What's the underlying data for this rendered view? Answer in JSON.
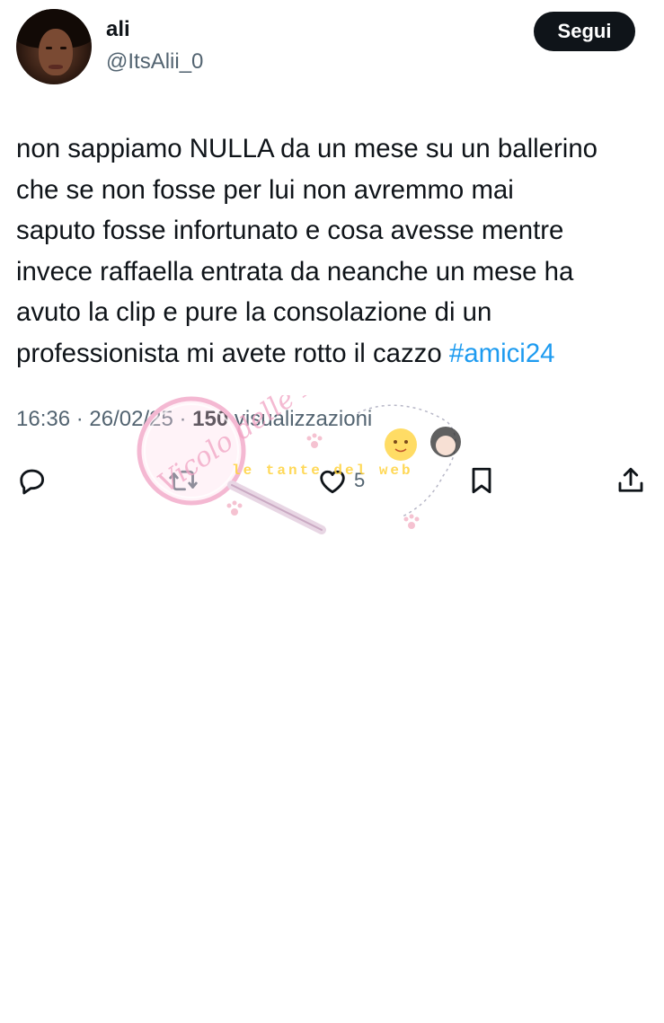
{
  "author": {
    "name": "ali",
    "handle": "@ItsAlii_0"
  },
  "follow_label": "Segui",
  "tweet": {
    "text": "non sappiamo NULLA da un mese su un ballerino\nche se non fosse per lui non avremmo mai\nsaputo fosse infortunato e cosa avesse mentre\ninvece raffaella entrata da neanche un mese ha\navuto la clip e pure la consolazione di un\nprofessionista mi avete rotto il cazzo ",
    "hashtag": "#amici24"
  },
  "meta": {
    "time": "16:36",
    "date": "26/02/25",
    "views_count": "150",
    "views_label": "visualizzazioni"
  },
  "actions": {
    "like_count": "5"
  },
  "watermark": {
    "script_text": "Vicolo delle News",
    "logo_text": "le tante del web"
  },
  "colors": {
    "accent": "#1d9bf0",
    "text": "#0f1419",
    "muted": "#536471",
    "button_bg": "#0f1419"
  },
  "icons": [
    "reply-icon",
    "retweet-icon",
    "like-icon",
    "bookmark-icon",
    "share-icon"
  ]
}
